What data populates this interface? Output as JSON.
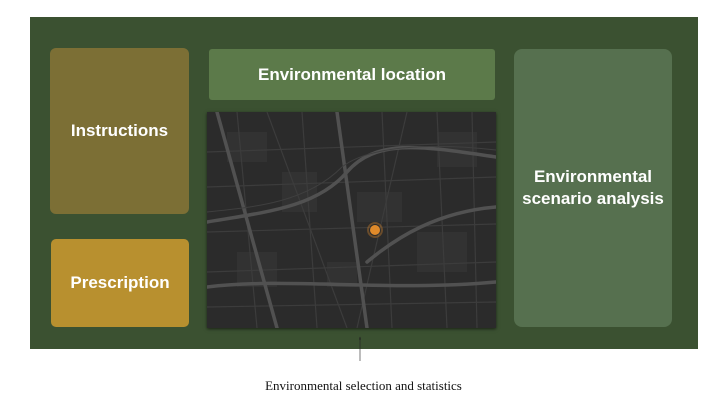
{
  "diagram": {
    "instructions_label": "Instructions",
    "prescription_label": "Prescription",
    "location_label": "Environmental location",
    "scenario_label": "Environmental scenario analysis",
    "caption": "Environmental selection and statistics"
  },
  "colors": {
    "panel_bg": "#3b5131",
    "instructions_bg": "#7c6f35",
    "prescription_bg": "#b8902f",
    "location_bg": "#5c7a4a",
    "scenario_bg": "#56704f",
    "map_bg": "#2d2d2d",
    "location_marker": "#e08a2a"
  },
  "icons": {
    "map_marker": "location-marker-icon",
    "arrow": "arrow-up-icon"
  }
}
